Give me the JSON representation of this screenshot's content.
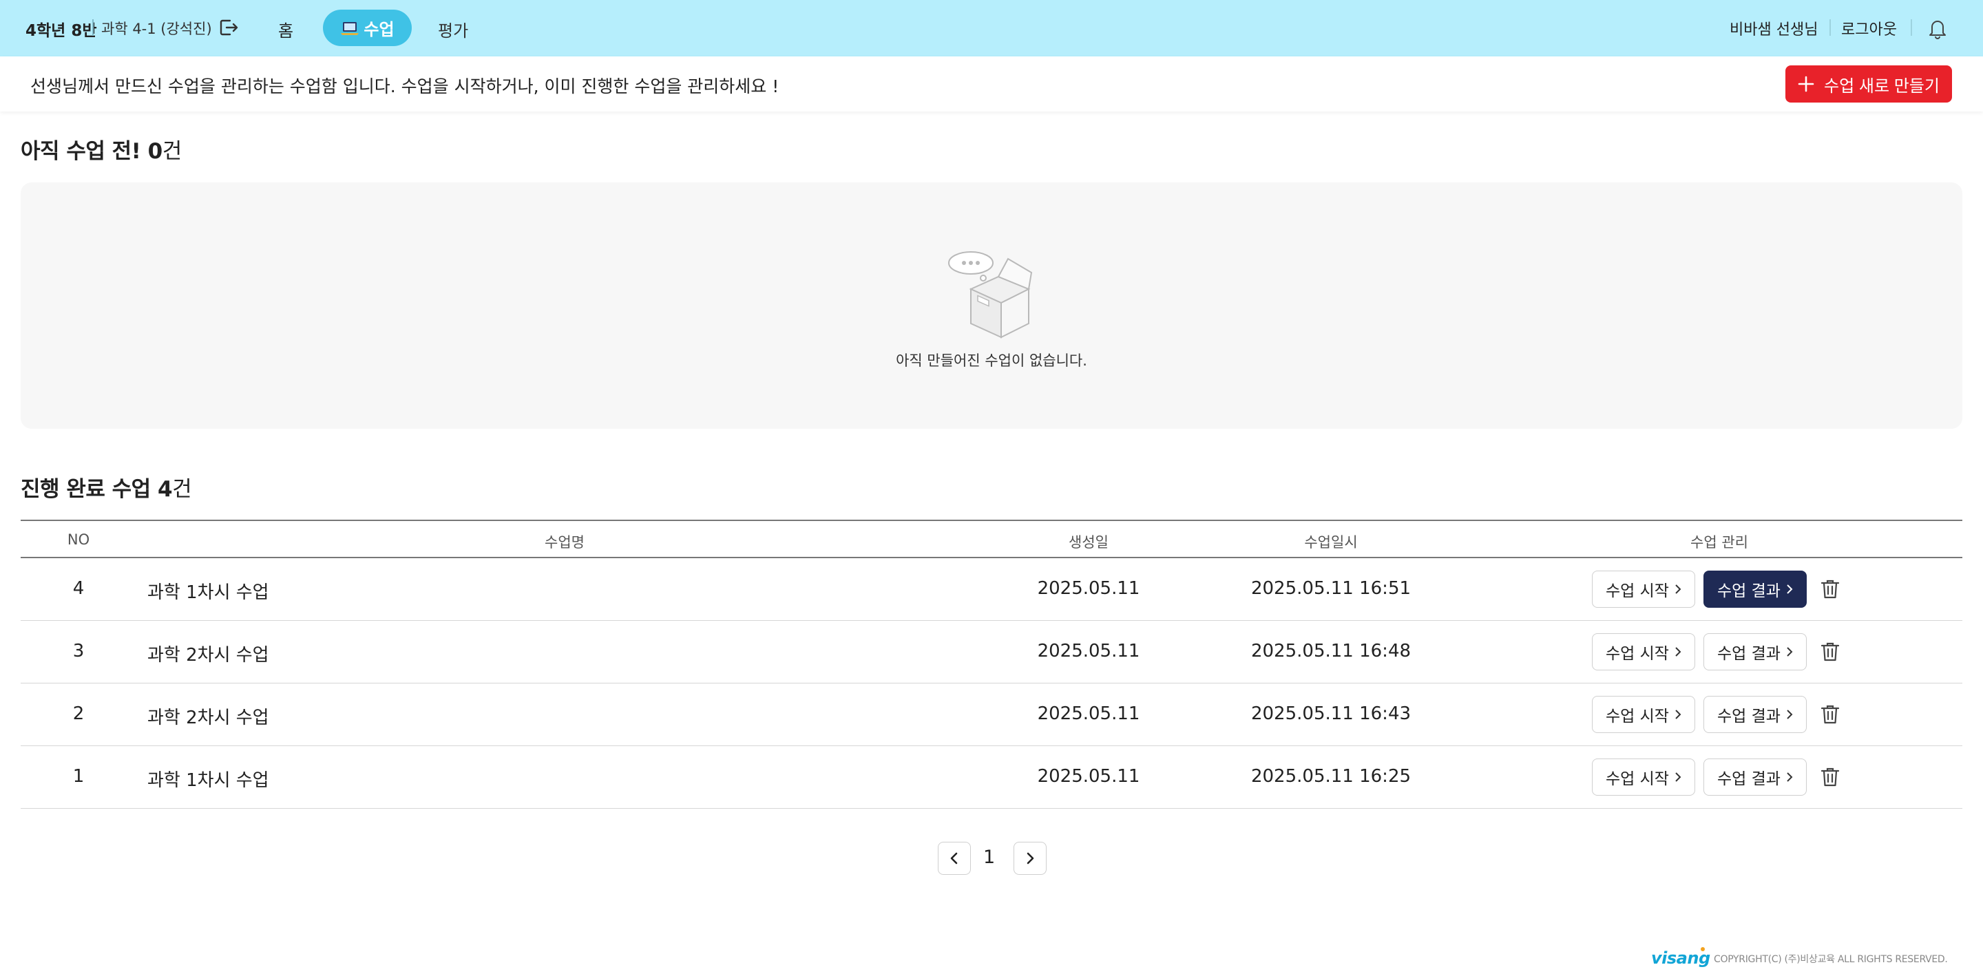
{
  "header": {
    "class_name": "4학년 8반",
    "subject": "과학 4-1 (강석진)",
    "nav": {
      "home": "홈",
      "lesson": "수업",
      "evaluation": "평가"
    },
    "teacher": "비바샘 선생님",
    "logout": "로그아웃"
  },
  "info": {
    "text": "선생님께서 만드신 수업을 관리하는 수업함 입니다. 수업을 시작하거나, 이미 진행한 수업을 관리하세요 !",
    "create_button": "수업 새로 만들기"
  },
  "pending": {
    "title_prefix": "아직 수업 전!",
    "count": "0",
    "unit": "건",
    "empty_message": "아직 만들어진 수업이 없습니다."
  },
  "completed": {
    "title_prefix": "진행 완료 수업",
    "count": "4",
    "unit": "건",
    "columns": {
      "no": "NO",
      "name": "수업명",
      "created": "생성일",
      "datetime": "수업일시",
      "manage": "수업 관리"
    },
    "start_label": "수업 시작",
    "result_label": "수업 결과",
    "rows": [
      {
        "no": "4",
        "name": "과학 1차시 수업",
        "created": "2025.05.11",
        "datetime": "2025.05.11 16:51"
      },
      {
        "no": "3",
        "name": "과학 2차시 수업",
        "created": "2025.05.11",
        "datetime": "2025.05.11 16:48"
      },
      {
        "no": "2",
        "name": "과학 2차시 수업",
        "created": "2025.05.11",
        "datetime": "2025.05.11 16:43"
      },
      {
        "no": "1",
        "name": "과학 1차시 수업",
        "created": "2025.05.11",
        "datetime": "2025.05.11 16:25"
      }
    ]
  },
  "pagination": {
    "current": "1"
  },
  "footer": {
    "logo": "visang",
    "copyright": "COPYRIGHT(C) (주)비상교육 ALL RIGHTS RESERVED."
  },
  "colors": {
    "topbar": "#b6eefc",
    "nav_active": "#3fc2e6",
    "create_button": "#e8222a",
    "result_active": "#1f2a55"
  }
}
